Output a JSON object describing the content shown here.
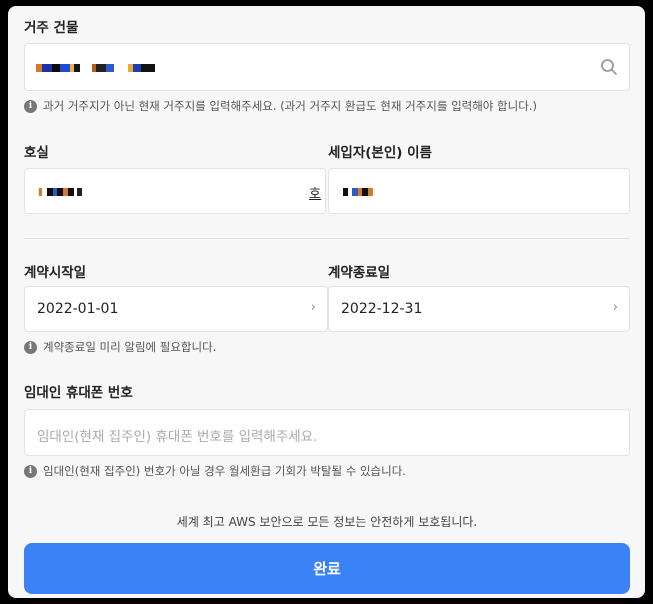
{
  "form": {
    "building": {
      "label": "거주 건물",
      "help": "과거 거주지가 아닌 현재 거주지를 입력해주세요. (과거 거주지 환급도 현재 거주지를 입력해야 합니다.)"
    },
    "room": {
      "label": "호실",
      "suffix": "호"
    },
    "tenant_name": {
      "label": "세입자(본인) 이름"
    },
    "contract_start": {
      "label": "계약시작일",
      "value": "2022-01-01"
    },
    "contract_end": {
      "label": "계약종료일",
      "value": "2022-12-31"
    },
    "contract_help": "계약종료일 미리 알림에 필요합니다.",
    "landlord_phone": {
      "label": "임대인 휴대폰 번호",
      "placeholder": "임대인(현재 집주인) 휴대폰 번호를 입력해주세요.",
      "help": "임대인(현재 집주인) 번호가 아닐 경우 월세환급 기회가 박탈될 수 있습니다."
    },
    "security_notice": "세계 최고 AWS 보안으로 모든 정보는 안전하게 보호됩니다.",
    "submit_label": "완료"
  },
  "icons": {
    "search": "search-icon",
    "info": "info-icon",
    "chevron": "chevron-right-icon"
  },
  "colors": {
    "primary": "#3b82f6",
    "background": "#f7f7f8"
  }
}
